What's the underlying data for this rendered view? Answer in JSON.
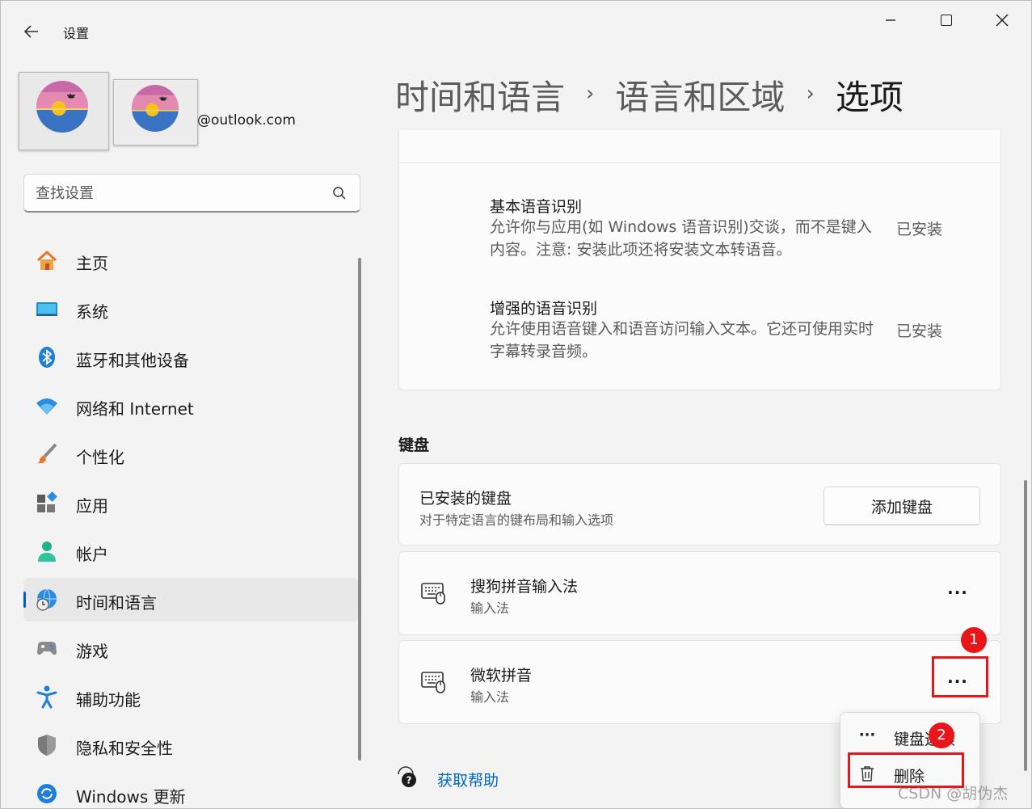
{
  "window": {
    "title": "设置",
    "controls": {
      "minimize": "—",
      "maximize": "",
      "close": "✕"
    }
  },
  "profile": {
    "email": "@outlook.com"
  },
  "search": {
    "placeholder": "查找设置"
  },
  "nav": {
    "items": [
      {
        "label": "主页",
        "icon": "home-icon",
        "selected": false
      },
      {
        "label": "系统",
        "icon": "system-icon",
        "selected": false
      },
      {
        "label": "蓝牙和其他设备",
        "icon": "bluetooth-icon",
        "selected": false
      },
      {
        "label": "网络和 Internet",
        "icon": "wifi-icon",
        "selected": false
      },
      {
        "label": "个性化",
        "icon": "brush-icon",
        "selected": false
      },
      {
        "label": "应用",
        "icon": "apps-icon",
        "selected": false
      },
      {
        "label": "帐户",
        "icon": "account-icon",
        "selected": false
      },
      {
        "label": "时间和语言",
        "icon": "time-language-icon",
        "selected": true
      },
      {
        "label": "游戏",
        "icon": "gamepad-icon",
        "selected": false
      },
      {
        "label": "辅助功能",
        "icon": "accessibility-icon",
        "selected": false
      },
      {
        "label": "隐私和安全性",
        "icon": "shield-icon",
        "selected": false
      },
      {
        "label": "Windows 更新",
        "icon": "update-icon",
        "selected": false
      }
    ]
  },
  "breadcrumb": {
    "part1": "时间和语言",
    "part2": "语言和区域",
    "current": "选项",
    "separator": "›"
  },
  "speech": {
    "features": [
      {
        "title": "基本语音识别",
        "desc": "允许你与应用(如 Windows 语音识别)交谈，而不是键入内容。注意: 安装此项还将安装文本转语音。",
        "status": "已安装"
      },
      {
        "title": "增强的语音识别",
        "desc": "允许使用语音键入和语音访问输入文本。它还可使用实时字幕转录音频。",
        "status": "已安装"
      }
    ]
  },
  "keyboard": {
    "section_title": "键盘",
    "header_title": "已安装的键盘",
    "header_desc": "对于特定语言的键布局和输入选项",
    "add_button": "添加键盘",
    "items": [
      {
        "name": "搜狗拼音输入法",
        "type": "输入法",
        "more": "···"
      },
      {
        "name": "微软拼音",
        "type": "输入法",
        "more": "···"
      }
    ]
  },
  "help": {
    "link": "获取帮助"
  },
  "context_menu": {
    "items": [
      {
        "label": "键盘选项",
        "icon": "more-icon",
        "glyph": "···"
      },
      {
        "label": "删除",
        "icon": "trash-icon"
      }
    ]
  },
  "annotations": {
    "badge1": "1",
    "badge2": "2",
    "color": "#e8151b"
  },
  "watermark": "CSDN @胡伪杰",
  "colors": {
    "accent": "#005fb8",
    "link": "#0067c0",
    "annotation": "#e8151b"
  }
}
